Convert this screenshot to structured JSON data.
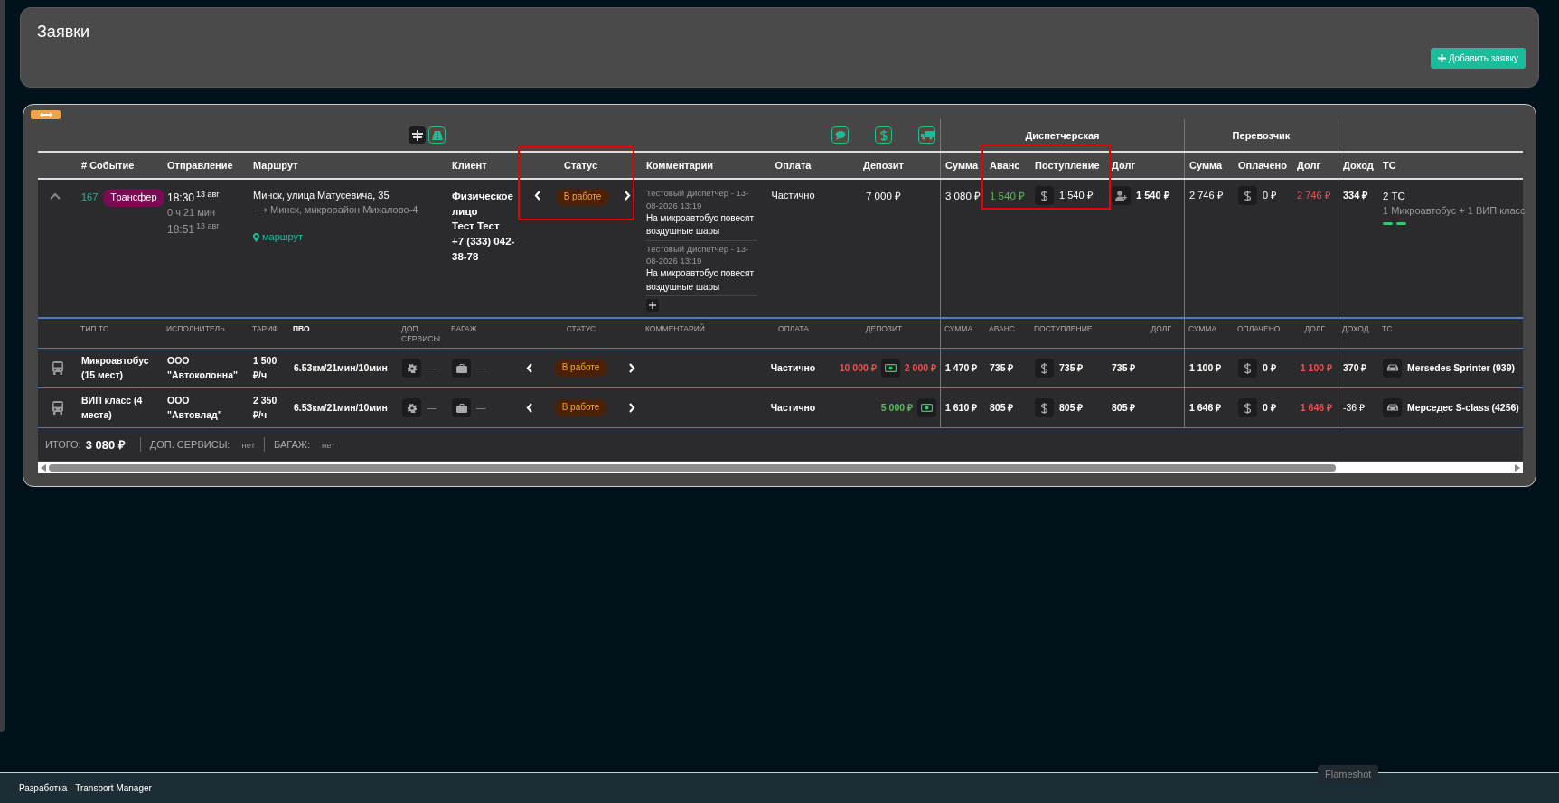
{
  "page": {
    "title": "Заявки",
    "add_button": "Добавить заявку"
  },
  "group_headers": [
    "Диспетчерская",
    "Перевозчик"
  ],
  "columns": [
    "# Событие",
    "Отправление",
    "Маршрут",
    "Клиент",
    "Статус",
    "Комментарии",
    "Оплата",
    "Депозит",
    "Сумма",
    "Аванс",
    "Поступление",
    "Долг",
    "Сумма",
    "Оплачено",
    "Долг",
    "Доход",
    "ТС"
  ],
  "order": {
    "expanded": true,
    "number": "167",
    "type": "Трансфер",
    "depart_time": "18:30",
    "depart_date": "13 авг",
    "duration": "0 ч 21 мин",
    "arrive_time": "18:51",
    "arrive_date": "13 авг",
    "route_from": "Минск, улица Матусевича, 35",
    "route_to": "⟶ Минск, микрорайон Михалово-4",
    "route_link": "маршрут",
    "client_type": "Физическое лицо",
    "client_name": "Тест Тест",
    "client_phone": "+7 (333) 042-38-78",
    "status": "В работе",
    "comments": [
      {
        "meta": "Тестовый Диспетчер - 13-08-2026 13:19",
        "text": "На микроавтобус повесят воздушные шары"
      },
      {
        "meta": "Тестовый Диспетчер - 13-08-2026 13:19",
        "text": "На микроавтобус повесят воздушные шары"
      }
    ],
    "payment": "Частично",
    "deposit": "7 000 ₽",
    "disp_sum": "3 080 ₽",
    "disp_advance": "1 540 ₽",
    "disp_income": "1 540 ₽",
    "disp_debt": "1 540 ₽",
    "carrier_sum": "2 746 ₽",
    "carrier_paid": "0 ₽",
    "carrier_debt": "2 746 ₽",
    "profit": "334 ₽",
    "vehicles_count": "2 ТС",
    "vehicles_desc": "1 Микроавтобус + 1 ВИП класс"
  },
  "sub_columns": [
    {
      "label": "ТИП ТС",
      "selected": false
    },
    {
      "label": "ИСПОЛНИТЕЛЬ",
      "selected": false
    },
    {
      "label": "ТАРИФ",
      "selected": false
    },
    {
      "label": "ПВО",
      "selected": true
    },
    {
      "label": "ДОП СЕРВИСЫ",
      "selected": false
    },
    {
      "label": "БАГАЖ",
      "selected": false
    },
    {
      "label": "СТАТУС",
      "selected": false
    },
    {
      "label": "КОММЕНТАРИЙ",
      "selected": false
    },
    {
      "label": "ОПЛАТА",
      "selected": false
    },
    {
      "label": "ДЕПОЗИТ",
      "selected": false
    },
    {
      "label": "СУММА",
      "selected": false
    },
    {
      "label": "АВАНС",
      "selected": false
    },
    {
      "label": "ПОСТУПЛЕНИЕ",
      "selected": false
    },
    {
      "label": "ДОЛГ",
      "selected": false
    },
    {
      "label": "СУММА",
      "selected": false
    },
    {
      "label": "ОПЛАЧЕНО",
      "selected": false
    },
    {
      "label": "ДОЛГ",
      "selected": false
    },
    {
      "label": "ДОХОД",
      "selected": false
    },
    {
      "label": "ТС",
      "selected": false
    }
  ],
  "vehicles": [
    {
      "type": "Микроавтобус (15 мест)",
      "executor": "ООО \"Автоколонна\"",
      "tariff": "1 500 ₽/ч",
      "pvo": "6.53км/21мин/10мин",
      "services": "—",
      "baggage": "—",
      "status": "В работе",
      "payment": "Частично",
      "deposit": {
        "amount": "10 000 ₽",
        "overdue": true,
        "remainder": "2 000 ₽"
      },
      "sum": "1 470 ₽",
      "advance": "735 ₽",
      "income": "735 ₽",
      "debt": "735 ₽",
      "carrier_sum": "1 100 ₽",
      "carrier_paid": "0 ₽",
      "carrier_debt": "1 100 ₽",
      "profit": "370 ₽",
      "profit_emphasized": true,
      "vehicle": "Mersedes Sprinter (939)"
    },
    {
      "type": "ВИП класс (4 места)",
      "executor": "ООО \"Автовлад\"",
      "tariff": "2 350 ₽/ч",
      "pvo": "6.53км/21мин/10мин",
      "services": "—",
      "baggage": "—",
      "status": "В работе",
      "payment": "Частично",
      "deposit": {
        "amount": "5 000 ₽",
        "overdue": false
      },
      "sum": "1 610 ₽",
      "advance": "805 ₽",
      "income": "805 ₽",
      "debt": "805 ₽",
      "carrier_sum": "1 646 ₽",
      "carrier_paid": "0 ₽",
      "carrier_debt": "1 646 ₽",
      "profit": "-36 ₽",
      "profit_emphasized": false,
      "vehicle": "Мерседес S-class (4256)"
    }
  ],
  "totals": {
    "label": "ИТОГО:",
    "value": "3 080 ₽",
    "services_label": "ДОП. СЕРВИСЫ:",
    "services": "нет",
    "baggage_label": "БАГАЖ:",
    "baggage": "нет"
  },
  "status_bar": {
    "text": "Разработка - Transport Manager"
  },
  "tooltip": "Flameshot"
}
